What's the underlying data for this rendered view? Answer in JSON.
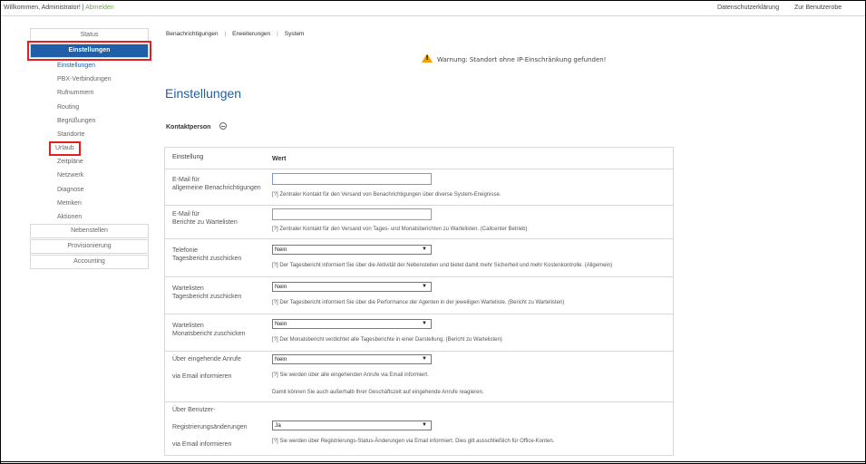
{
  "topbar": {
    "welcome": "Willkommen, Administrator!",
    "separator": " | ",
    "logout": "Abmelden",
    "privacy": "Datenschutzerklärung",
    "user_area": "Zur Benutzerobe"
  },
  "sidebar": {
    "status": "Status",
    "einstellungen": "Einstellungen",
    "sub": [
      "Einstellungen",
      "PBX-Verbindungen",
      "Rufnummern",
      "Routing",
      "Begrüßungen",
      "Standorte",
      "Urlaub",
      "Zeitpläne",
      "Netzwerk",
      "Diagnose",
      "Metriken",
      "Aktionen"
    ],
    "nebenstellen": "Nebenstellen",
    "provisionierung": "Provisionierung",
    "accounting": "Accounting"
  },
  "tabs": [
    "Benachrichtigungen",
    "Erweiterungen",
    "System"
  ],
  "tab_separator": "|",
  "warning": "Warnung: Standort ohne IP-Einschränkung gefunden!",
  "page_title": "Einstellungen",
  "section_title": "Kontaktperson",
  "table": {
    "head_setting": "Einstellung",
    "head_value": "Wert",
    "rows": [
      {
        "label1": "E-Mail für",
        "label2": "allgemeine Benachrichtigungen",
        "input_value": "",
        "help": "[?] Zentraler Kontakt für den Versand von Benachrichtigungen über diverse System-Ereignisse."
      },
      {
        "label1": "E-Mail für",
        "label2": "Berichte zu Wartelisten",
        "input_value": "",
        "help": "[?] Zentraler Kontakt für den Versand von Tages- und Monatsberichten zu Wartelisten. (Callcenter Betrieb)"
      },
      {
        "label1": "Telefonie",
        "label2": "Tagesbericht zuschicken",
        "select": "Nein",
        "help": "[?] Der Tagesbericht informiert Sie über die Aktivität der Nebenstellen und bietet damit mehr Sicherheit und mehr Kostenkontrolle. (Allgemein)"
      },
      {
        "label1": "Wartelisten",
        "label2": "Tagesbericht zuschicken",
        "select": "Nein",
        "help": "[?] Der Tagesbericht informiert Sie über die Performance der Agenten in der jeweiligen Warteliste. (Bericht zu Wartelisten)"
      },
      {
        "label1": "Wartelisten",
        "label2": "Monatsbericht zuschicken",
        "select": "Nein",
        "help": "[?] Der Monatsbericht verdichtet alle Tagesberichte in einer Darstellung. (Bericht zu Wartelisten)"
      },
      {
        "label1": "Über eingehende Anrufe",
        "label2": "via Email informieren",
        "select": "Nein",
        "help": "[?] Sie werden über alle eingehenden Anrufe via Email informiert.",
        "help2": "Damit können Sie auch außerhalb Ihrer Geschäftszeit auf eingehende Anrufe reagieren."
      },
      {
        "label1": "Über Benutzer-",
        "label2": "Registrierungsänderungen",
        "label3": "via Email informieren",
        "select": "Ja",
        "help": "[?] Sie werden über Registrierungs-Status-Änderungen via Email informiert. Dies gilt ausschließlich für Office-Konten."
      }
    ]
  },
  "colors": {
    "accent": "#1f5ea8",
    "highlight": "#e41f1f",
    "logout": "#6aa84f",
    "warning": "#f0a000"
  },
  "icons": {
    "warning": "warning-triangle-icon",
    "toggle": "collapse-toggle-icon",
    "dropdown": "chevron-down-icon"
  }
}
